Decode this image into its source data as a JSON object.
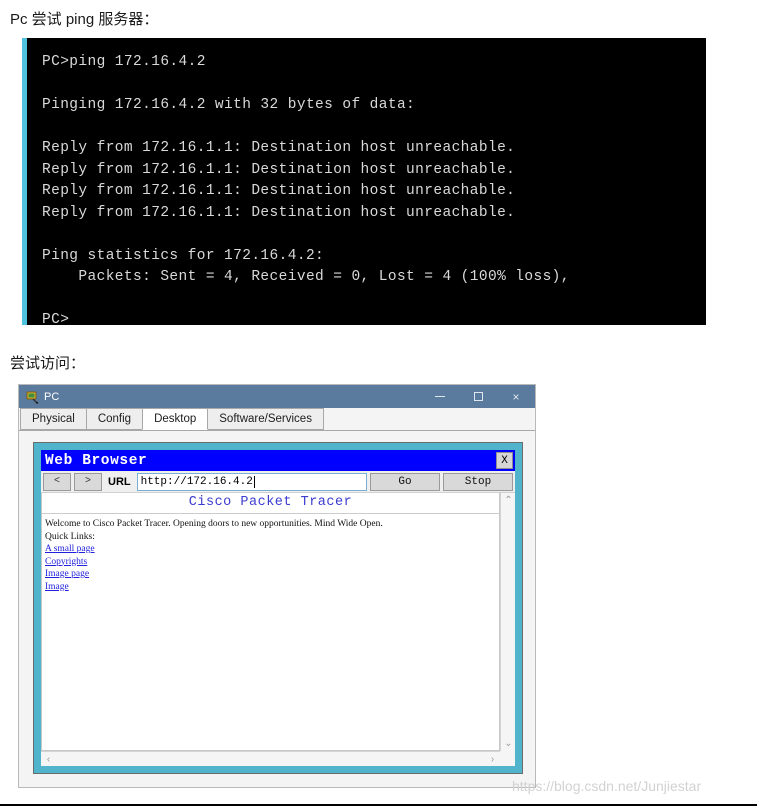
{
  "captions": {
    "ping": "Pc 尝试 ping 服务器：",
    "access": "尝试访问："
  },
  "terminal": {
    "lines": [
      "PC>ping 172.16.4.2",
      "",
      "Pinging 172.16.4.2 with 32 bytes of data:",
      "",
      "Reply from 172.16.1.1: Destination host unreachable.",
      "Reply from 172.16.1.1: Destination host unreachable.",
      "Reply from 172.16.1.1: Destination host unreachable.",
      "Reply from 172.16.1.1: Destination host unreachable.",
      "",
      "Ping statistics for 172.16.4.2:",
      "    Packets: Sent = 4, Received = 0, Lost = 4 (100% loss),",
      "",
      "PC>"
    ]
  },
  "pc_window": {
    "title": "PC",
    "icon": "pc-device-icon",
    "controls": {
      "minimize": "minimize-icon",
      "maximize": "maximize-icon",
      "close": "×"
    },
    "tabs": [
      {
        "label": "Physical",
        "active": false
      },
      {
        "label": "Config",
        "active": false
      },
      {
        "label": "Desktop",
        "active": true
      },
      {
        "label": "Software/Services",
        "active": false
      }
    ]
  },
  "browser": {
    "title": "Web Browser",
    "close_label": "X",
    "back_label": "<",
    "forward_label": ">",
    "url_label": "URL",
    "url_value": "http://172.16.4.2",
    "go_label": "Go",
    "stop_label": "Stop",
    "page": {
      "heading": "Cisco Packet Tracer",
      "welcome": "Welcome to Cisco Packet Tracer. Opening doors to new opportunities. Mind Wide Open.",
      "quick_links_label": "Quick Links:",
      "links": [
        "A small page",
        "Copyrights",
        "Image page",
        "Image"
      ]
    },
    "scroll": {
      "up": "⌃",
      "down": "⌄",
      "left": "‹",
      "right": "›"
    }
  },
  "watermark": "https://blog.csdn.net/Junjiestar",
  "colors": {
    "terminal_bg": "#000000",
    "terminal_text": "#d9d9d9",
    "terminal_accent": "#4fc3dd",
    "titlebar": "#5b7b9e",
    "browser_frame": "#4fb4cc",
    "browser_title_bg": "#0000ff",
    "page_heading": "#3b3bd0",
    "link": "#2020dd"
  }
}
